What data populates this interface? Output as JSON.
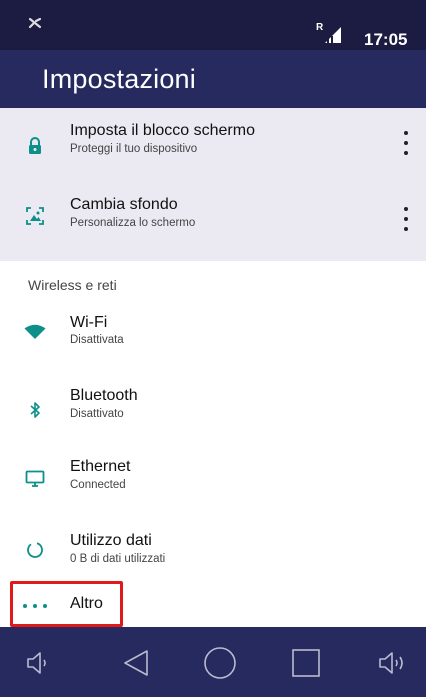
{
  "status_bar": {
    "left_icon": "x-icon",
    "signal_tag": "R",
    "clock": "17:05"
  },
  "app_bar": {
    "title": "Impostazioni"
  },
  "suggestions": [
    {
      "title": "Imposta il blocco schermo",
      "subtitle": "Proteggi il tuo dispositivo",
      "icon": "lock-icon"
    },
    {
      "title": "Cambia sfondo",
      "subtitle": "Personalizza lo schermo",
      "icon": "wallpaper-icon"
    }
  ],
  "section_header": "Wireless e reti",
  "items": [
    {
      "title": "Wi-Fi",
      "subtitle": "Disattivata",
      "icon": "wifi-icon"
    },
    {
      "title": "Bluetooth",
      "subtitle": "Disattivato",
      "icon": "bluetooth-icon"
    },
    {
      "title": "Ethernet",
      "subtitle": "Connected",
      "icon": "ethernet-icon"
    },
    {
      "title": "Utilizzo dati",
      "subtitle": "0 B di dati utilizzati",
      "icon": "data-usage-icon"
    },
    {
      "title": "Altro",
      "subtitle": "",
      "icon": "more-dots-icon"
    }
  ],
  "colors": {
    "status_bar": "#1c1c42",
    "app_bar": "#262a5e",
    "accent": "#0d8f8a",
    "suggestion_bg": "#ebeaf3",
    "highlight": "#e01a1a"
  }
}
